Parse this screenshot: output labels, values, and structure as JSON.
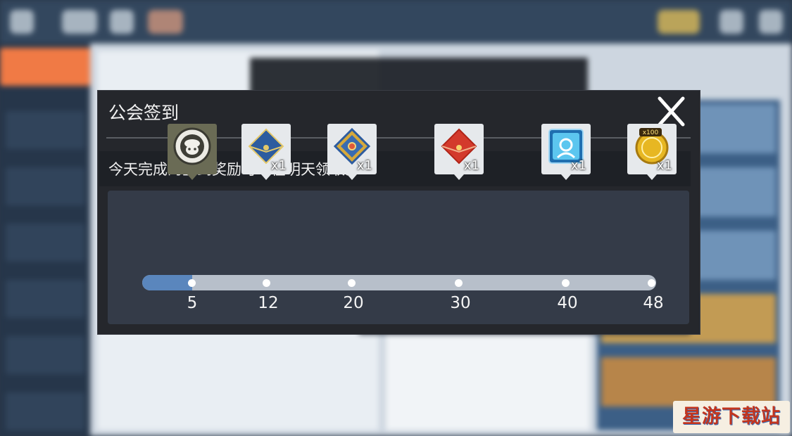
{
  "dialog": {
    "title": "公会签到",
    "notice": "今天完成的签到奖励可以在明天领取。"
  },
  "progress": {
    "current": 5,
    "max": 48,
    "milestones": [
      {
        "value": "5",
        "reward_icon": "guild-emblem-icon",
        "quantity": "",
        "claimed": true
      },
      {
        "value": "12",
        "reward_icon": "blue-envelope-icon",
        "quantity": "x1",
        "claimed": false
      },
      {
        "value": "20",
        "reward_icon": "blue-gold-envelope-icon",
        "quantity": "x1",
        "claimed": false
      },
      {
        "value": "30",
        "reward_icon": "red-envelope-icon",
        "quantity": "x1",
        "claimed": false
      },
      {
        "value": "40",
        "reward_icon": "summon-ticket-icon",
        "quantity": "x1",
        "claimed": false
      },
      {
        "value": "48",
        "reward_icon": "gold-coin-icon",
        "quantity": "x1",
        "coin_label": "x100",
        "claimed": false
      }
    ]
  },
  "watermark": "星游下载站",
  "colors": {
    "accent": "#f07a45",
    "progress_fill": "#5a86bd",
    "dialog_bg": "#25272c"
  }
}
